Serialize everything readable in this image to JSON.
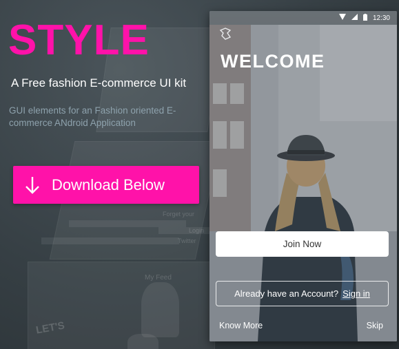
{
  "brand": {
    "title": "STYLE",
    "color": "#ff12a9"
  },
  "tagline": "A Free fashion E-commerce UI kit",
  "subtitle": "GUI elements for an Fashion oriented E-commerce ANdroid Application",
  "download_button": {
    "label": "Download Below",
    "icon": "arrow-down-icon"
  },
  "phone": {
    "status": {
      "time": "12:30",
      "icons": [
        "wifi-icon",
        "signal-icon",
        "battery-icon"
      ]
    },
    "welcome": "WELCOME",
    "join_button": "Join Now",
    "account_prompt": "Already have an Account?",
    "signin_link": "Sign in",
    "know_more": "Know More",
    "skip": "Skip"
  },
  "background_mockups": {
    "texts": [
      "Forget your",
      "Login",
      "Twitter",
      "My Feed",
      "LET'S"
    ]
  }
}
